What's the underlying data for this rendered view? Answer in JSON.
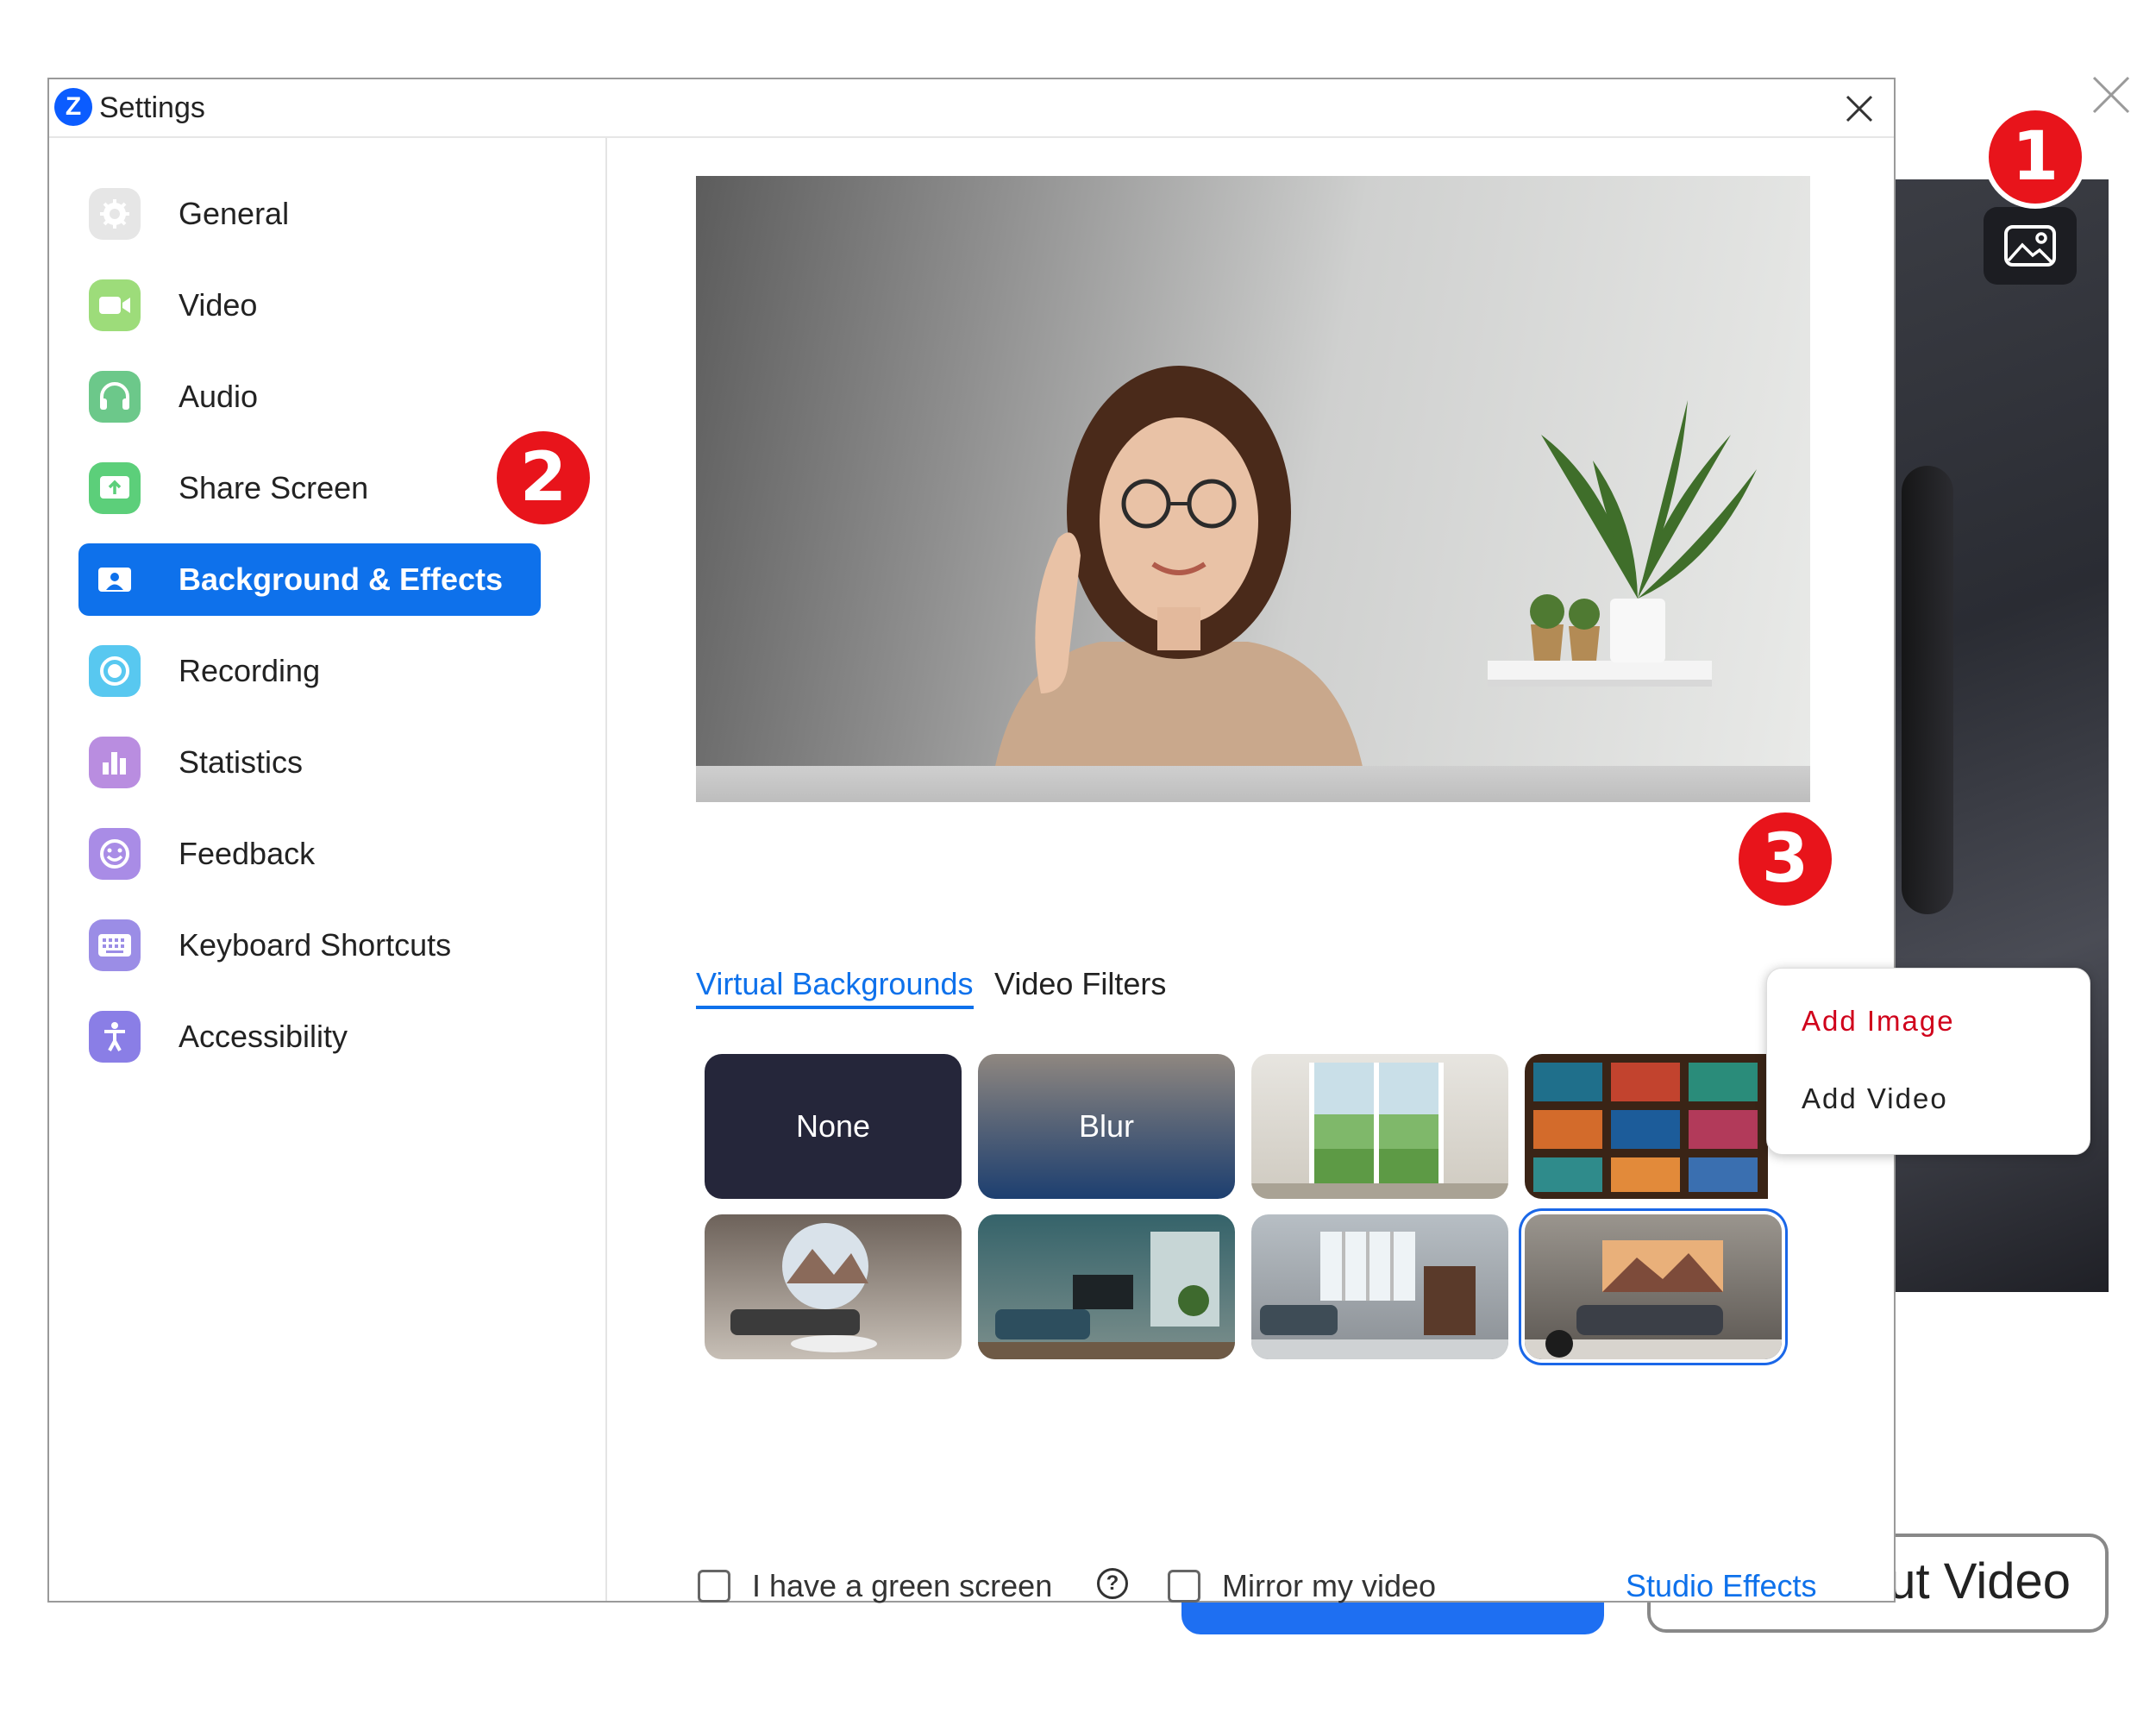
{
  "window": {
    "title": "Settings",
    "logo_letter": "Z"
  },
  "sidebar": {
    "items": [
      {
        "label": "General",
        "icon": "gear-icon",
        "color": "#e3e3e3"
      },
      {
        "label": "Video",
        "icon": "video-camera-icon",
        "color": "#9ddc7a"
      },
      {
        "label": "Audio",
        "icon": "headphones-icon",
        "color": "#6cc88a"
      },
      {
        "label": "Share Screen",
        "icon": "share-screen-icon",
        "color": "#5ccf7a"
      },
      {
        "label": "Background & Effects",
        "icon": "background-icon",
        "color": "#0e71eb",
        "active": true
      },
      {
        "label": "Recording",
        "icon": "record-icon",
        "color": "#58c8f0"
      },
      {
        "label": "Statistics",
        "icon": "bar-chart-icon",
        "color": "#b98de0"
      },
      {
        "label": "Feedback",
        "icon": "smiley-icon",
        "color": "#a98ce6"
      },
      {
        "label": "Keyboard Shortcuts",
        "icon": "keyboard-icon",
        "color": "#9b8de6"
      },
      {
        "label": "Accessibility",
        "icon": "accessibility-icon",
        "color": "#8a7ee6"
      }
    ]
  },
  "tabs": [
    {
      "label": "Virtual Backgrounds",
      "active": true
    },
    {
      "label": "Video Filters",
      "active": false
    }
  ],
  "backgrounds": [
    {
      "label": "None",
      "kind": "solid",
      "color": "#25263a"
    },
    {
      "label": "Blur",
      "kind": "blur"
    },
    {
      "label": "",
      "kind": "garden-window"
    },
    {
      "label": "",
      "kind": "bookshelf"
    },
    {
      "label": "",
      "kind": "living-room-round-window"
    },
    {
      "label": "",
      "kind": "living-room-teal"
    },
    {
      "label": "",
      "kind": "living-room-bright"
    },
    {
      "label": "",
      "kind": "living-room-mountain-art",
      "selected": true
    }
  ],
  "add_menu": {
    "items": [
      "Add  Image",
      "Add  Video"
    ],
    "highlight_color": "#d0021b"
  },
  "options": {
    "green_screen_label": "I have a green screen",
    "mirror_label": "Mirror my video",
    "studio_effects": "Studio Effects"
  },
  "badges": [
    "1",
    "2",
    "3"
  ],
  "background_app": {
    "button_label": "ut Video"
  },
  "colors": {
    "accent": "#0e71eb",
    "badge": "#e8141b"
  }
}
